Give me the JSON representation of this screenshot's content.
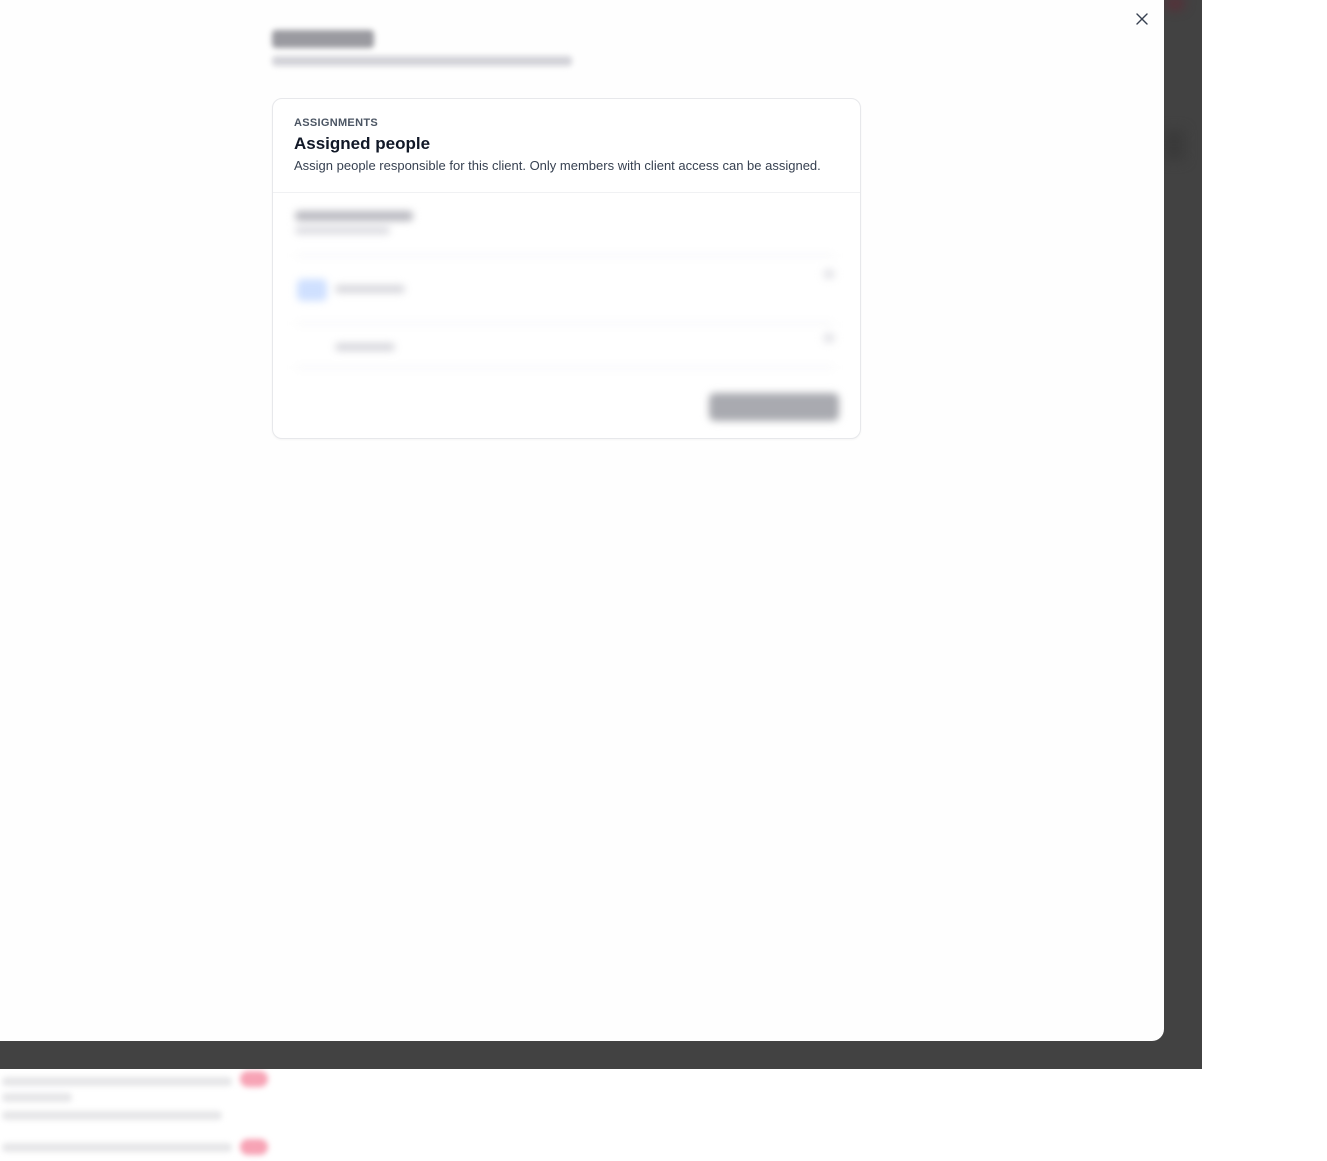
{
  "modal": {
    "close_icon": "close-icon",
    "card": {
      "eyebrow": "ASSIGNMENTS",
      "title": "Assigned people",
      "description": "Assign people responsible for this client. Only members with client access can be assigned."
    }
  },
  "colors": {
    "overlay": "#424242",
    "card_border": "#e7e8eb",
    "title": "#111827",
    "text": "#374151",
    "accent_pink": "#f7a3b5"
  }
}
